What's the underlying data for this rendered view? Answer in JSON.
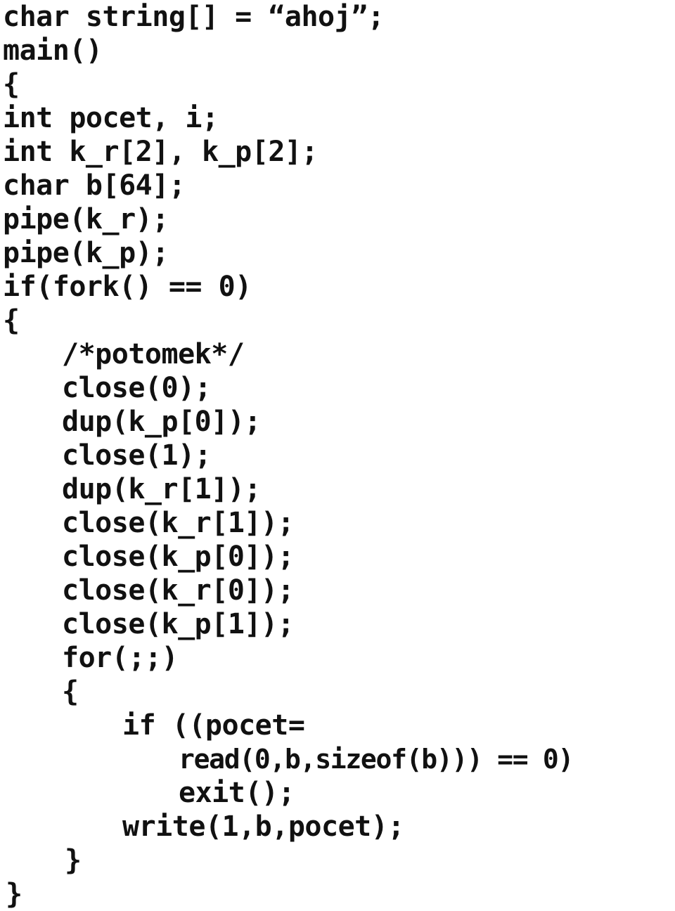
{
  "document": {
    "kind": "source-code-listing",
    "language": "C",
    "background_color": "#ffffff",
    "text_color": "#111111"
  },
  "code": {
    "lines": [
      {
        "text": "char string[] = “ahoj”;",
        "indent": 0,
        "condensed": false
      },
      {
        "text": "main()",
        "indent": 0,
        "condensed": false
      },
      {
        "text": "{",
        "indent": 0,
        "condensed": false
      },
      {
        "text": "int pocet, i;",
        "indent": 0,
        "condensed": false
      },
      {
        "text": "int k_r[2], k_p[2];",
        "indent": 0,
        "condensed": false
      },
      {
        "text": "char b[64];",
        "indent": 0,
        "condensed": false
      },
      {
        "text": "pipe(k_r);",
        "indent": 0,
        "condensed": false
      },
      {
        "text": "pipe(k_p);",
        "indent": 0,
        "condensed": false
      },
      {
        "text": "if(fork() == 0)",
        "indent": 0,
        "condensed": false
      },
      {
        "text": "{",
        "indent": 0,
        "condensed": false
      },
      {
        "text": "/*potomek*/",
        "indent": 1,
        "condensed": false
      },
      {
        "text": "close(0);",
        "indent": 1,
        "condensed": false
      },
      {
        "text": "dup(k_p[0]);",
        "indent": 1,
        "condensed": false
      },
      {
        "text": "close(1);",
        "indent": 1,
        "condensed": false
      },
      {
        "text": "dup(k_r[1]);",
        "indent": 1,
        "condensed": false
      },
      {
        "text": "close(k_r[1]);",
        "indent": 1,
        "condensed": false
      },
      {
        "text": "close(k_p[0]);",
        "indent": 1,
        "condensed": false
      },
      {
        "text": "close(k_r[0]);",
        "indent": 1,
        "condensed": false
      },
      {
        "text": "close(k_p[1]);",
        "indent": 1,
        "condensed": false
      },
      {
        "text": "for(;;)",
        "indent": 1,
        "condensed": false
      },
      {
        "text": "{",
        "indent": 1,
        "condensed": false
      },
      {
        "text": "if ((pocet=",
        "indent": 2,
        "condensed": false
      },
      {
        "text": "read(0,b,sizeof(b))) == 0)",
        "indent": 3,
        "condensed": true
      },
      {
        "text": "exit();",
        "indent": 3,
        "condensed": false
      },
      {
        "text": "write(1,b,pocet);",
        "indent": 2,
        "condensed": false
      },
      {
        "text": "}",
        "indent": 1,
        "condensed": false
      },
      {
        "text": "}",
        "indent": 0,
        "condensed": false
      }
    ]
  }
}
